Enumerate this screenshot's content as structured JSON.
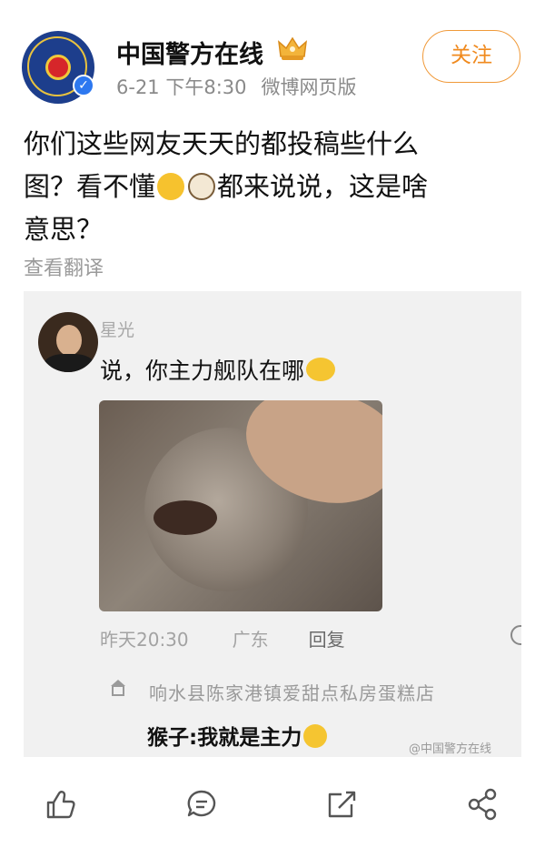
{
  "author": {
    "name": "中国警方在线",
    "time": "6-21 下午8:30",
    "source": "微博网页版",
    "verified_icon": "verified-v-icon",
    "badge_icon": "crown-badge-icon"
  },
  "follow_button": "关注",
  "post": {
    "line1": "你们这些网友天天的都投稿些什么",
    "line2_a": "图？看不懂",
    "line2_b": "都来说说，这是啥",
    "line3": "意思？",
    "translate": "查看翻译"
  },
  "image": {
    "commenter": "星光",
    "comment": "说，你主力舰队在哪",
    "time": "昨天20:30",
    "location": "广东",
    "reply": "回复",
    "shop": "响水县陈家港镇爱甜点私房蛋糕店",
    "caption": "猴子:我就是主力",
    "watermark": "@中国警方在线"
  },
  "actions": [
    {
      "name": "like",
      "icon": "thumbs-up-icon"
    },
    {
      "name": "comment",
      "icon": "comment-icon"
    },
    {
      "name": "repost",
      "icon": "repost-icon"
    },
    {
      "name": "share",
      "icon": "share-icon"
    }
  ],
  "colors": {
    "accent": "#f08a1e",
    "verified": "#2d78f0",
    "meta_text": "#8a8a8a"
  }
}
